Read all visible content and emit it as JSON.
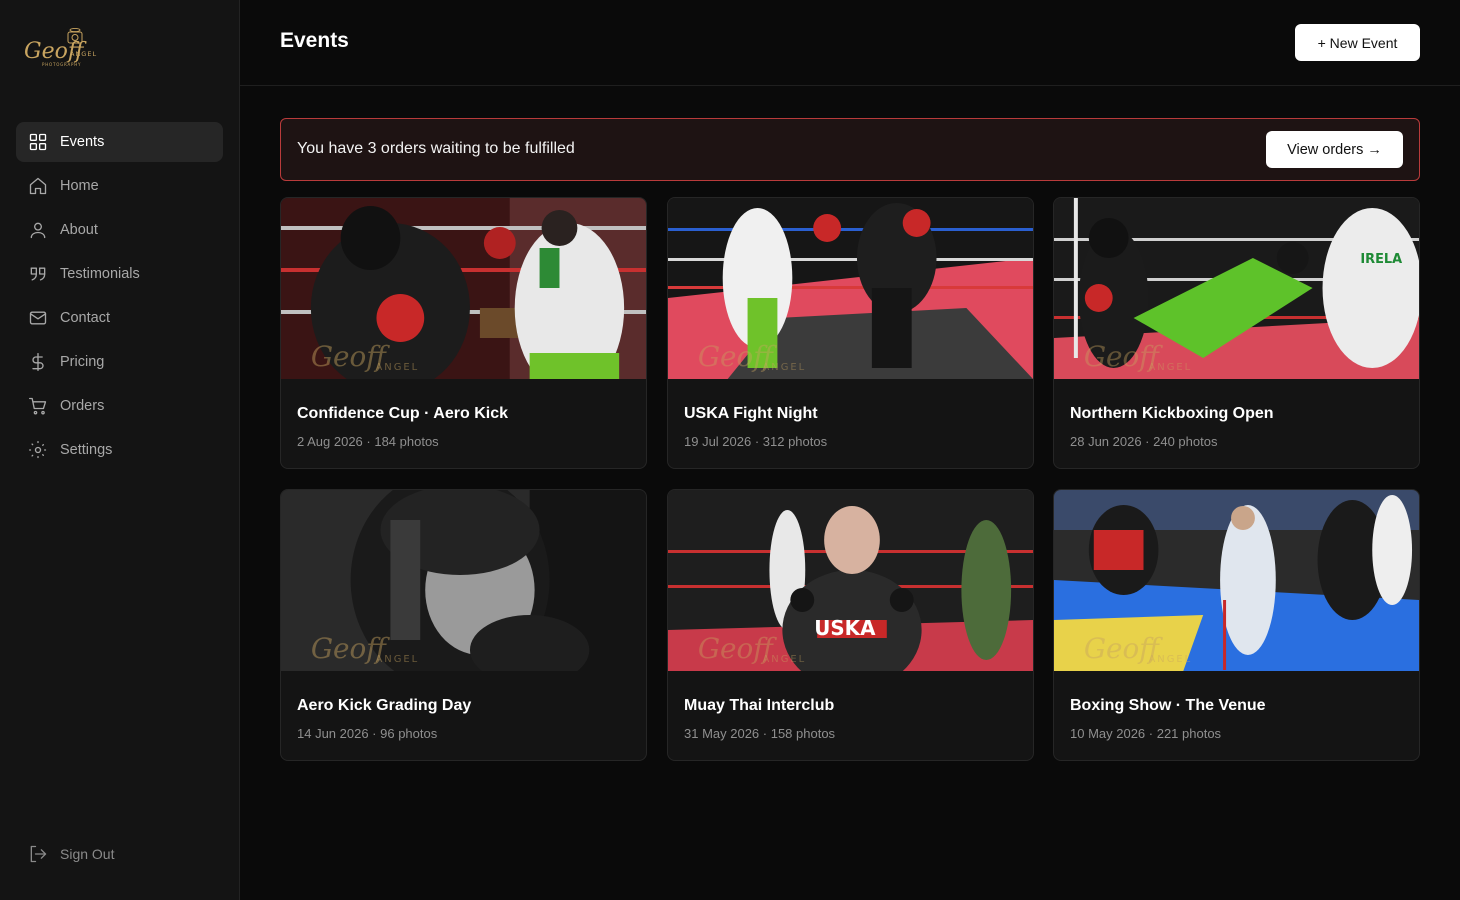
{
  "sidebar": {
    "logo_text": "Geoff ANGEL PHOTOGRAPHY",
    "items": [
      {
        "label": "Events",
        "icon": "grid-icon",
        "active": true
      },
      {
        "label": "Home",
        "icon": "home-icon"
      },
      {
        "label": "About",
        "icon": "user-icon"
      },
      {
        "label": "Testimonials",
        "icon": "quote-icon"
      },
      {
        "label": "Contact",
        "icon": "mail-icon"
      },
      {
        "label": "Pricing",
        "icon": "dollar-icon"
      },
      {
        "label": "Orders",
        "icon": "cart-icon"
      },
      {
        "label": "Settings",
        "icon": "settings-icon"
      }
    ],
    "signout": {
      "label": "Sign Out",
      "icon": "logout-icon"
    }
  },
  "header": {
    "title": "Events",
    "new_event_label": "+ New Event"
  },
  "alert": {
    "text": "You have 3 orders waiting to be fulfilled",
    "button_label": "View orders →",
    "accent": "#b93b3b"
  },
  "events": [
    {
      "title": "Confidence Cup · Aero Kick",
      "meta": "2 Aug 2026 · 184 photos"
    },
    {
      "title": "USKA Fight Night",
      "meta": "19 Jul 2026 · 312 photos"
    },
    {
      "title": "Northern Kickboxing Open",
      "meta": "28 Jun 2026 · 240 photos"
    },
    {
      "title": "Aero Kick Grading Day",
      "meta": "14 Jun 2026 · 96 photos"
    },
    {
      "title": "Muay Thai Interclub",
      "meta": "31 May 2026 · 158 photos"
    },
    {
      "title": "Boxing Show · The Venue",
      "meta": "10 May 2026 · 221 photos"
    }
  ]
}
